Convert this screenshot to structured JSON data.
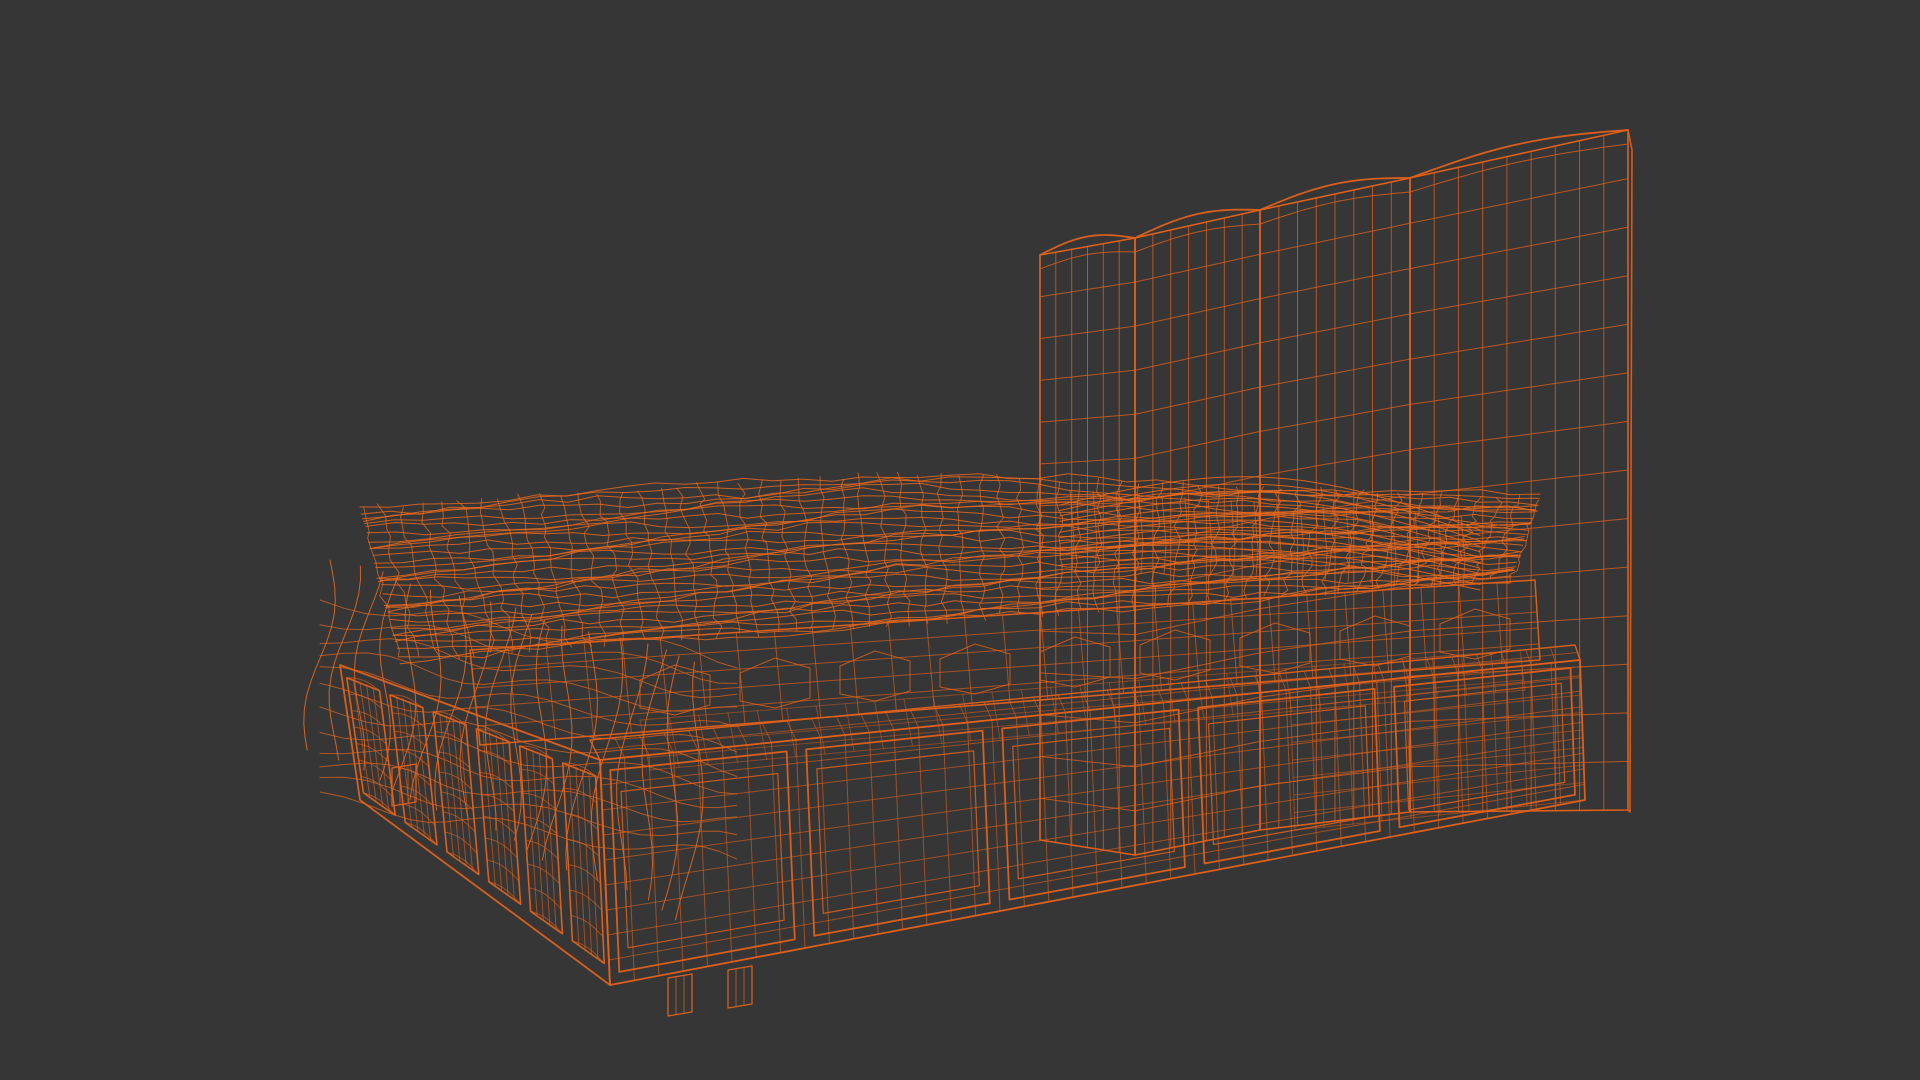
{
  "viewport": {
    "background_color": "#363636",
    "wire_color": "#e0621c",
    "wire_color_dense": "#ef6b1e",
    "render_mode": "wireframe",
    "object": "bed"
  }
}
